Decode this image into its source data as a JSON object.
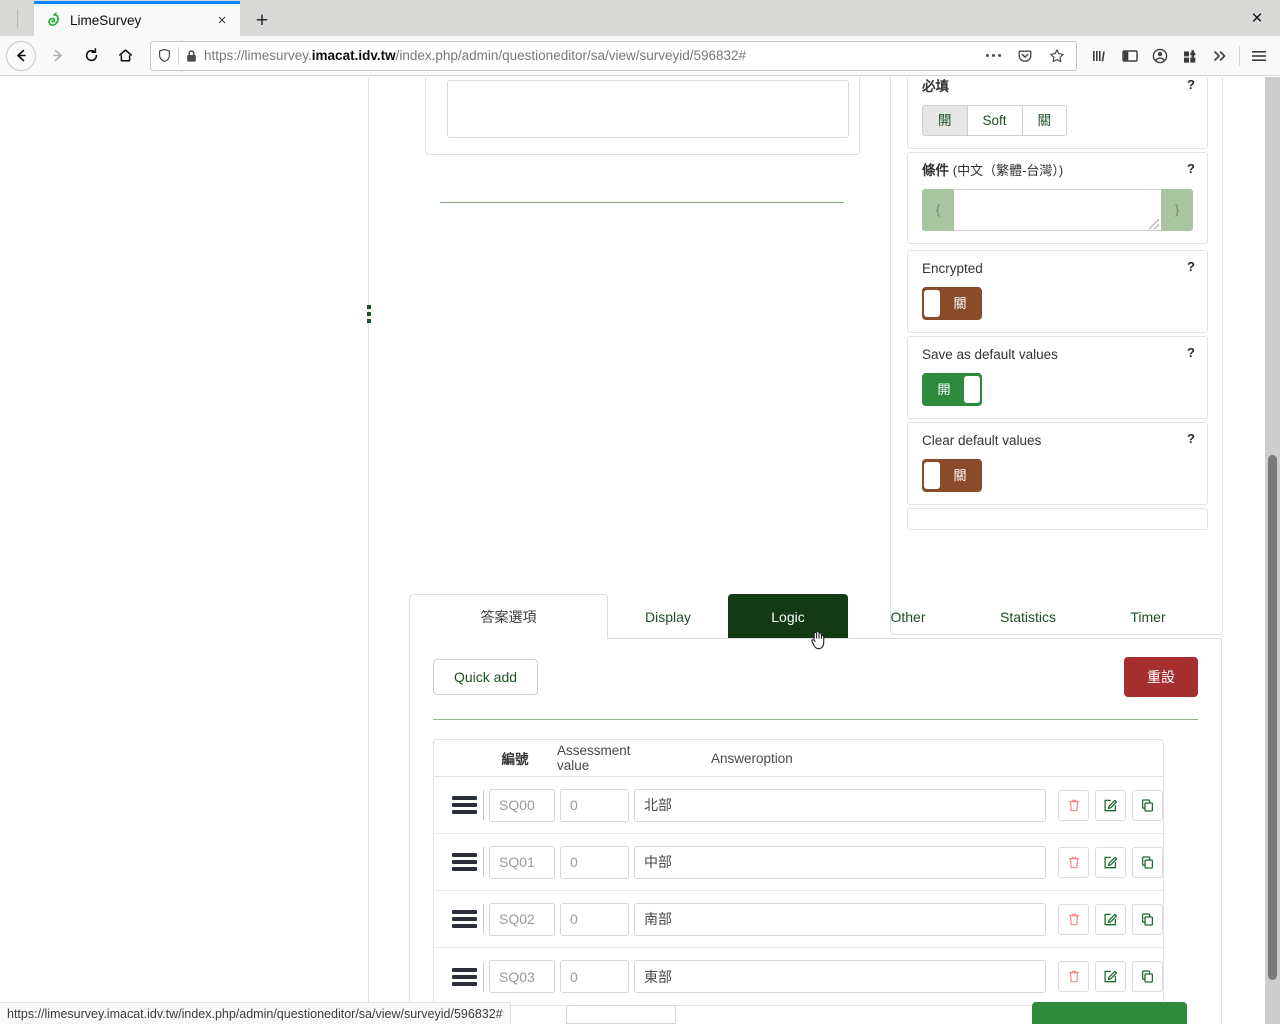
{
  "browser": {
    "tab": {
      "title": "LimeSurvey",
      "favicon": "limesurvey-icon",
      "close_label": "×"
    },
    "newtab_label": "+",
    "window_controls": {
      "minimize": "—",
      "maximize": "□",
      "close": "✕"
    },
    "nav": {
      "back_icon": "back-arrow-icon",
      "forward_icon": "forward-arrow-icon",
      "reload_icon": "reload-icon",
      "home_icon": "home-icon"
    },
    "url": {
      "prefix": "https://limesurvey.",
      "host_bold": "imacat.idv.tw",
      "path": "/index.php/admin/questioneditor/sa/view/surveyid/596832#",
      "full": "https://limesurvey.imacat.idv.tw/index.php/admin/questioneditor/sa/view/surveyid/596832#",
      "shield_icon": "tracking-shield-icon",
      "lock_icon": "padlock-icon",
      "page_actions_icon": "ellipsis-icon",
      "pocket_icon": "pocket-icon",
      "bookmark_icon": "star-icon"
    },
    "toolbar_icons": [
      "library-icon",
      "sidebar-icon",
      "account-icon",
      "extensions-icon",
      "overflow-chevrons-icon",
      "hamburger-menu-icon"
    ],
    "statusbar": {
      "link": "https://limesurvey.imacat.idv.tw/index.php/admin/questioneditor/sa/view/surveyid/596832#"
    }
  },
  "settings": {
    "mandatory": {
      "label": "必填",
      "help": "?",
      "options": [
        {
          "label": "開",
          "selected": true
        },
        {
          "label": "Soft",
          "selected": false
        },
        {
          "label": "關",
          "selected": false
        }
      ]
    },
    "condition": {
      "label": "條件",
      "label_sub": "(中文（繁體-台灣）)",
      "help": "?",
      "addon_left": "{",
      "addon_right": "}",
      "value": "",
      "resize_handle": "resize-grip-icon"
    },
    "encrypted": {
      "label": "Encrypted",
      "help": "?",
      "state_label": "關",
      "on": false
    },
    "save_default": {
      "label": "Save as default values",
      "help": "?",
      "state_label": "開",
      "on": true
    },
    "clear_default": {
      "label": "Clear default values",
      "help": "?",
      "state_label": "關",
      "on": false
    }
  },
  "tabs": [
    {
      "label": "答案選項",
      "state": "active"
    },
    {
      "label": "Display",
      "state": "normal"
    },
    {
      "label": "Logic",
      "state": "hovered"
    },
    {
      "label": "Other",
      "state": "normal"
    },
    {
      "label": "Statistics",
      "state": "normal"
    },
    {
      "label": "Timer",
      "state": "normal"
    }
  ],
  "panel": {
    "quick_add": "Quick add",
    "reset": "重設",
    "columns": {
      "code": "編號",
      "assessment": "Assessment value",
      "answeroption": "Answeroption"
    },
    "rows": [
      {
        "code": "SQ00",
        "assessment": "0",
        "answer": "北部"
      },
      {
        "code": "SQ01",
        "assessment": "0",
        "answer": "中部"
      },
      {
        "code": "SQ02",
        "assessment": "0",
        "answer": "南部"
      },
      {
        "code": "SQ03",
        "assessment": "0",
        "answer": "東部"
      }
    ],
    "row_actions": {
      "delete": "trash-icon",
      "edit": "pencil-square-icon",
      "copy": "copy-icon",
      "drag": "drag-handle-icon"
    }
  },
  "colors": {
    "accent_green": "#2e8b3d",
    "tab_hover_green": "#123a14",
    "reset_red": "#a52f2f",
    "toggle_off_brown": "#8a4b2a",
    "addon_green": "#a8c4a0",
    "link_blue": "#0a84ff"
  }
}
